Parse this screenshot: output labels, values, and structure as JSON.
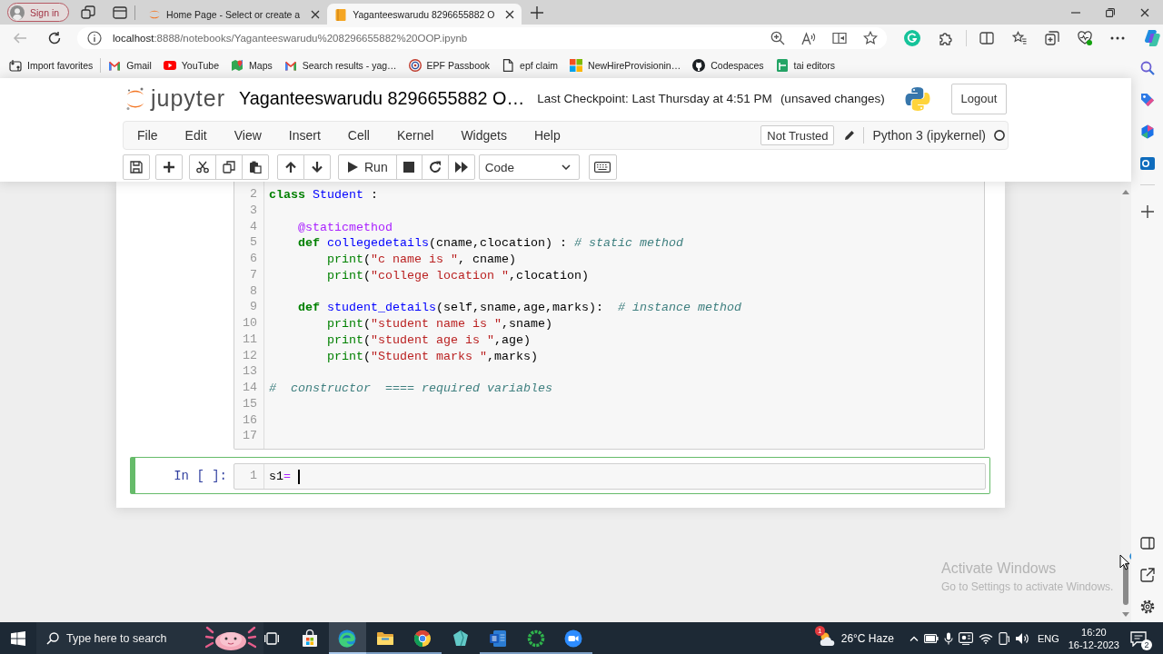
{
  "browser": {
    "profile_label": "Sign in",
    "tabs": [
      {
        "title": "Home Page - Select or create a",
        "selected": false
      },
      {
        "title": "Yaganteeswarudu 8296655882 O",
        "selected": true
      }
    ],
    "address": {
      "host": "localhost",
      "path": ":8888/notebooks/Yaganteeswarudu%208296655882%20OOP.ipynb"
    },
    "bookmarks": [
      "Import favorites",
      "Gmail",
      "YouTube",
      "Maps",
      "Search results - yag…",
      "EPF Passbook",
      "epf claim",
      "NewHireProvisionin…",
      "Codespaces",
      "tai editors"
    ]
  },
  "jupyter": {
    "logo": "jupyter",
    "notebook_title": "Yaganteeswarudu 8296655882 O…",
    "checkpoint": "Last Checkpoint: Last Thursday at 4:51 PM",
    "save_status": "(unsaved changes)",
    "logout": "Logout",
    "menu": [
      "File",
      "Edit",
      "View",
      "Insert",
      "Cell",
      "Kernel",
      "Widgets",
      "Help"
    ],
    "trust": "Not Trusted",
    "kernel": {
      "name": "Python 3 (ipykernel)",
      "busy": false
    },
    "toolbar": {
      "run": "Run",
      "cell_type": "Code"
    },
    "cells": [
      {
        "selected": false,
        "lines": [
          {
            "number": "2",
            "tokens": [
              {
                "kind": "keyword",
                "text": "class"
              },
              {
                "kind": "definition",
                "text": " Student"
              },
              {
                "kind": "plain",
                "text": " :"
              }
            ]
          },
          {
            "number": "3"
          },
          {
            "number": "4",
            "tokens": [
              {
                "kind": "decorator",
                "text": "    @staticmethod"
              }
            ]
          },
          {
            "number": "5",
            "tokens": [
              {
                "kind": "keyword",
                "text": "    def"
              },
              {
                "kind": "definition",
                "text": " collegedetails"
              },
              {
                "kind": "plain",
                "text": "(cname,clocation) : "
              },
              {
                "kind": "comment",
                "text": "# static method"
              }
            ]
          },
          {
            "number": "6",
            "tokens": [
              {
                "kind": "builtin",
                "text": "        print"
              },
              {
                "kind": "plain",
                "text": "("
              },
              {
                "kind": "string",
                "text": "\"c name is \""
              },
              {
                "kind": "plain",
                "text": ", cname)"
              }
            ]
          },
          {
            "number": "7",
            "tokens": [
              {
                "kind": "builtin",
                "text": "        print"
              },
              {
                "kind": "plain",
                "text": "("
              },
              {
                "kind": "string",
                "text": "\"college location \""
              },
              {
                "kind": "plain",
                "text": ",clocation)"
              }
            ]
          },
          {
            "number": "8"
          },
          {
            "number": "9",
            "tokens": [
              {
                "kind": "keyword",
                "text": "    def"
              },
              {
                "kind": "definition",
                "text": " student_details"
              },
              {
                "kind": "plain",
                "text": "(self,sname,age,marks):  "
              },
              {
                "kind": "comment",
                "text": "# instance method"
              }
            ]
          },
          {
            "number": "10",
            "tokens": [
              {
                "kind": "builtin",
                "text": "        print"
              },
              {
                "kind": "plain",
                "text": "("
              },
              {
                "kind": "string",
                "text": "\"student name is \""
              },
              {
                "kind": "plain",
                "text": ",sname)"
              }
            ]
          },
          {
            "number": "11",
            "tokens": [
              {
                "kind": "builtin",
                "text": "        print"
              },
              {
                "kind": "plain",
                "text": "("
              },
              {
                "kind": "string",
                "text": "\"student age is \""
              },
              {
                "kind": "plain",
                "text": ",age)"
              }
            ]
          },
          {
            "number": "12",
            "tokens": [
              {
                "kind": "builtin",
                "text": "        print"
              },
              {
                "kind": "plain",
                "text": "("
              },
              {
                "kind": "string",
                "text": "\"Student marks \""
              },
              {
                "kind": "plain",
                "text": ",marks)"
              }
            ]
          },
          {
            "number": "13"
          },
          {
            "number": "14",
            "tokens": [
              {
                "kind": "comment",
                "text": "#  constructor  ==== required variables"
              }
            ]
          },
          {
            "number": "15"
          },
          {
            "number": "16"
          },
          {
            "number": "17"
          }
        ]
      },
      {
        "selected": true,
        "prompt": "In [ ]:",
        "lines": [
          {
            "number": "1",
            "tokens": [
              {
                "kind": "plain",
                "text": "s1"
              },
              {
                "kind": "operator",
                "text": "= "
              }
            ]
          }
        ]
      }
    ]
  },
  "activation_notice": {
    "title": "Activate Windows",
    "message": "Go to Settings to activate Windows."
  },
  "taskbar": {
    "search_placeholder": "Type here to search",
    "apps": [
      {
        "running": false,
        "selected": false
      },
      {
        "running": true,
        "selected": true
      },
      {
        "running": true,
        "selected": false
      },
      {
        "running": true,
        "selected": false
      },
      {
        "running": false,
        "selected": false
      },
      {
        "running": true,
        "selected": false
      },
      {
        "running": true,
        "selected": false
      },
      {
        "running": true,
        "selected": false
      }
    ],
    "weather": {
      "badge": "1",
      "text": "26°C Haze"
    },
    "language": "ENG",
    "time": "16:20",
    "date": "16-12-2023",
    "notification_count": "2"
  }
}
